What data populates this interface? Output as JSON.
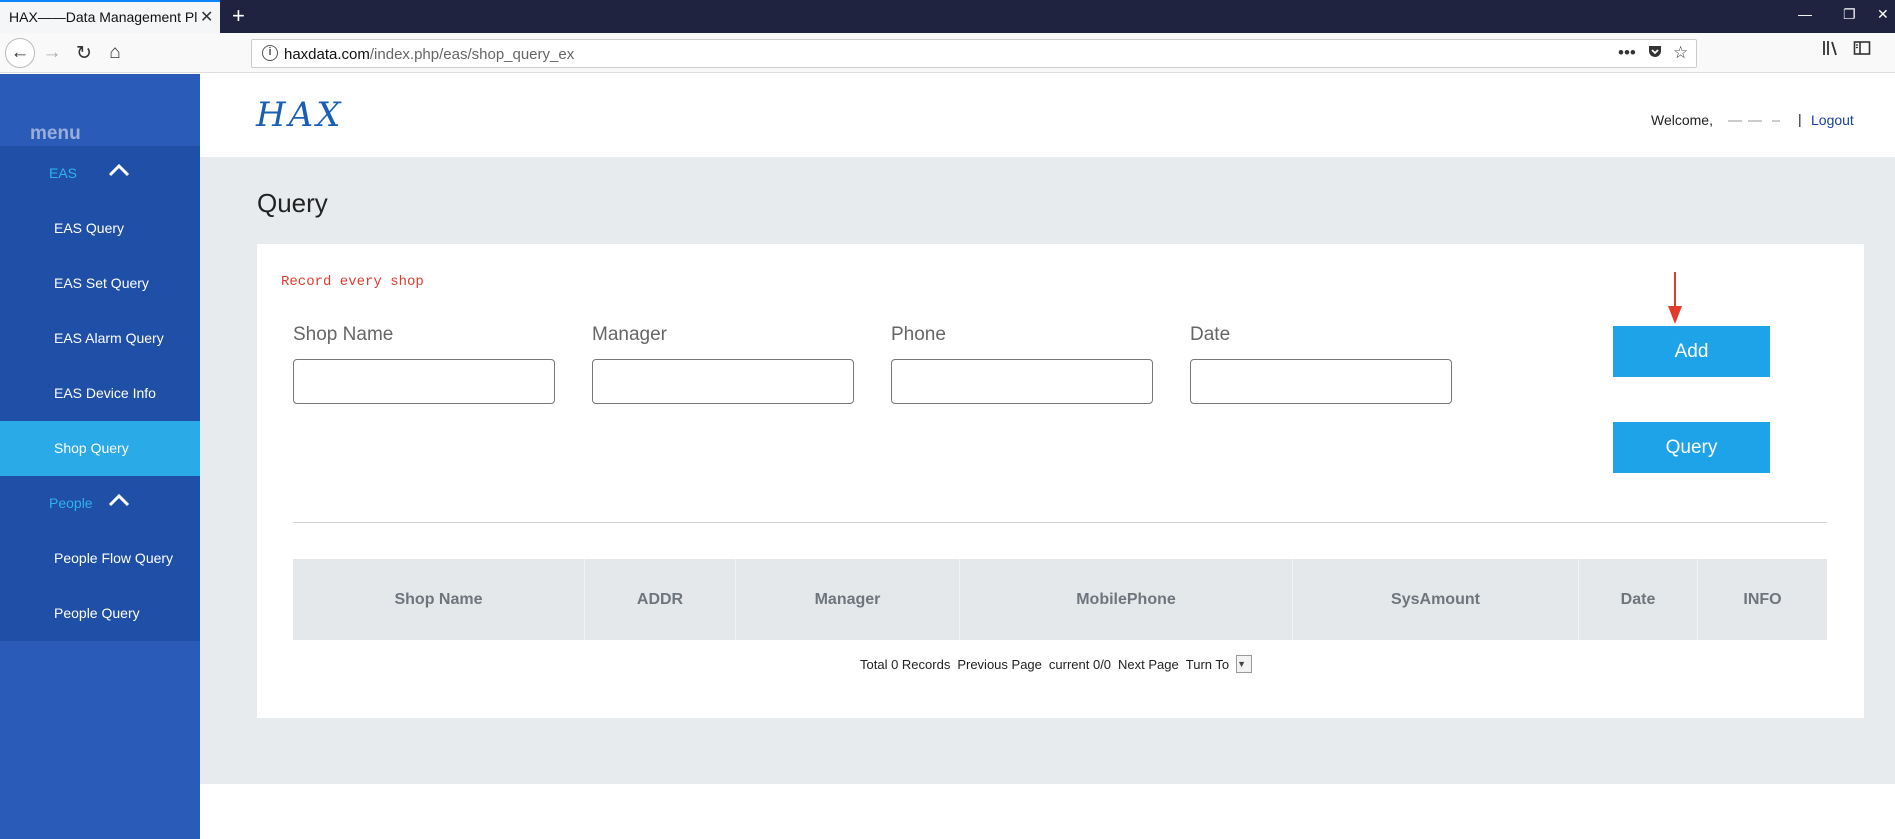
{
  "browser": {
    "tab_title": "HAX——Data Management Platform",
    "url_domain": "haxdata.com",
    "url_path": "/index.php/eas/shop_query_ex"
  },
  "sidebar": {
    "menu_title": "menu",
    "groups": [
      {
        "label": "EAS",
        "items": [
          {
            "label": "EAS Query",
            "active": false
          },
          {
            "label": "EAS Set Query",
            "active": false
          },
          {
            "label": "EAS Alarm Query",
            "active": false
          },
          {
            "label": "EAS Device Info",
            "active": false
          },
          {
            "label": "Shop Query",
            "active": true
          }
        ]
      },
      {
        "label": "People",
        "items": [
          {
            "label": "People Flow Query",
            "active": false
          },
          {
            "label": "People Query",
            "active": false
          }
        ]
      }
    ]
  },
  "header": {
    "logo_text": "HAX",
    "welcome": "Welcome,",
    "separator": "|",
    "logout": "Logout"
  },
  "main": {
    "title": "Query",
    "note": "Record every shop",
    "fields": [
      {
        "label": "Shop Name",
        "value": ""
      },
      {
        "label": "Manager",
        "value": ""
      },
      {
        "label": "Phone",
        "value": ""
      },
      {
        "label": "Date",
        "value": ""
      }
    ],
    "add_button": "Add",
    "query_button": "Query",
    "table_headers": [
      "Shop Name",
      "ADDR",
      "Manager",
      "MobilePhone",
      "SysAmount",
      "Date",
      "INFO"
    ],
    "pager": {
      "total": "Total 0 Records",
      "previous": "Previous Page",
      "current": "current 0/0",
      "next": "Next Page",
      "turn_to": "Turn To"
    }
  },
  "colors": {
    "sidebar_bg": "#2b5bb8",
    "sidebar_list_bg": "#1f4fa6",
    "active_item": "#2aaae6",
    "button": "#1fa3e8",
    "note": "#e23b2e"
  }
}
